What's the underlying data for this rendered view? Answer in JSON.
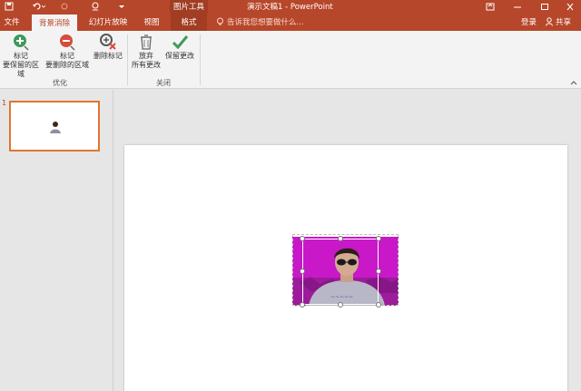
{
  "titlebar": {
    "context_tab": "图片工具",
    "doc_title": "演示文稿1 - PowerPoint"
  },
  "tabs": {
    "file": "文件",
    "background_removal": "背景消除",
    "slideshow": "幻灯片放映",
    "view": "视图",
    "format": "格式"
  },
  "tellme": {
    "placeholder": "告诉我您想要做什么..."
  },
  "account": {
    "signin": "登录",
    "share": "共享"
  },
  "ribbon": {
    "refine_group": "优化",
    "close_group": "关闭",
    "mark_keep_line1": "标记",
    "mark_keep_line2": "要保留的区域",
    "mark_remove_line1": "标记",
    "mark_remove_line2": "要删除的区域",
    "delete_mark": "删除标记",
    "discard_line1": "放弃",
    "discard_line2": "所有更改",
    "keep_changes": "保留更改"
  },
  "thumbnails": {
    "slide_number": "1"
  },
  "colors": {
    "accent": "#b7472a",
    "mask_magenta": "#c818c8",
    "keep_green": "#3e9a5a",
    "remove_red": "#d64d3a"
  }
}
